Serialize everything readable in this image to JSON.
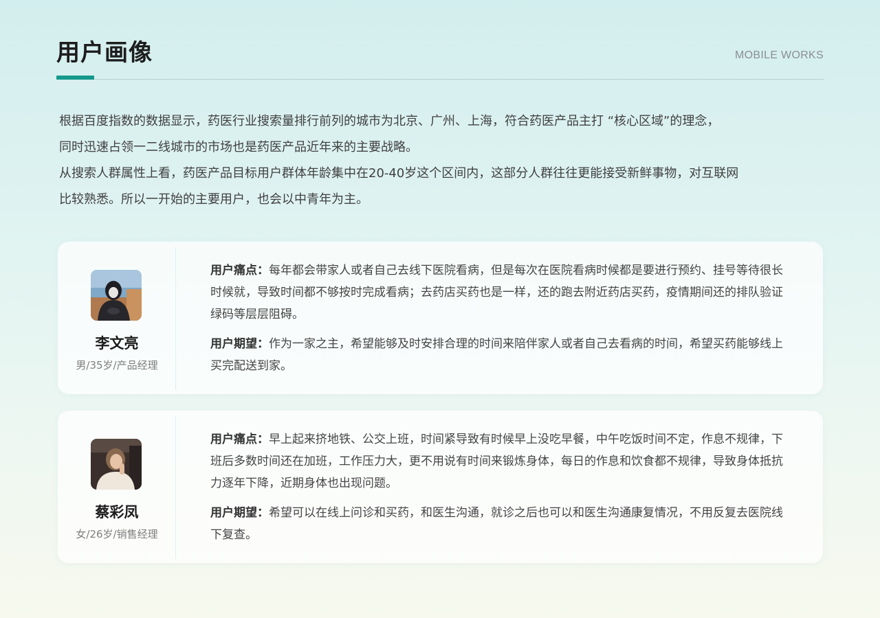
{
  "header": {
    "title": "用户画像",
    "subtitle": "MOBILE WORKS"
  },
  "intro": {
    "lines": [
      "根据百度指数的数据显示，药医行业搜索量排行前列的城市为北京、广州、上海，符合药医产品主打 “核心区域”的理念，",
      "同时迅速占领一二线城市的市场也是药医产品近年来的主要战略。",
      "从搜索人群属性上看，药医产品目标用户群体年龄集中在20-40岁这个区间内，这部分人群往往更能接受新鲜事物，对互联网",
      "比较熟悉。所以一开始的主要用户，也会以中青年为主。"
    ]
  },
  "personas": [
    {
      "name": "李文亮",
      "meta": "男/35岁/产品经理",
      "pain_label": "用户痛点：",
      "pain_text": "每年都会带家人或者自己去线下医院看病，但是每次在医院看病时候都是要进行预约、挂号等待很长时候就，导致时间都不够按时完成看病；去药店买药也是一样，还的跑去附近药店买药，疫情期间还的排队验证绿码等层层阻碍。",
      "hope_label": "用户期望：",
      "hope_text": "作为一家之主，希望能够及时安排合理的时间来陪伴家人或者自己去看病的时间，希望买药能够线上买完配送到家。"
    },
    {
      "name": "蔡彩凤",
      "meta": "女/26岁/销售经理",
      "pain_label": "用户痛点：",
      "pain_text": "早上起来挤地铁、公交上班，时间紧导致有时候早上没吃早餐，中午吃饭时间不定，作息不规律，下班后多数时间还在加班，工作压力大，更不用说有时间来锻炼身体，每日的作息和饮食都不规律，导致身体抵抗力逐年下降，近期身体也出现问题。",
      "hope_label": "用户期望：",
      "hope_text": "希望可以在线上问诊和买药，和医生沟通，就诊之后也可以和医生沟通康复情况，不用反复去医院线下复查。"
    }
  ],
  "colors": {
    "accent": "#16998c",
    "title": "#1d1d1d",
    "body_text": "#404040"
  }
}
